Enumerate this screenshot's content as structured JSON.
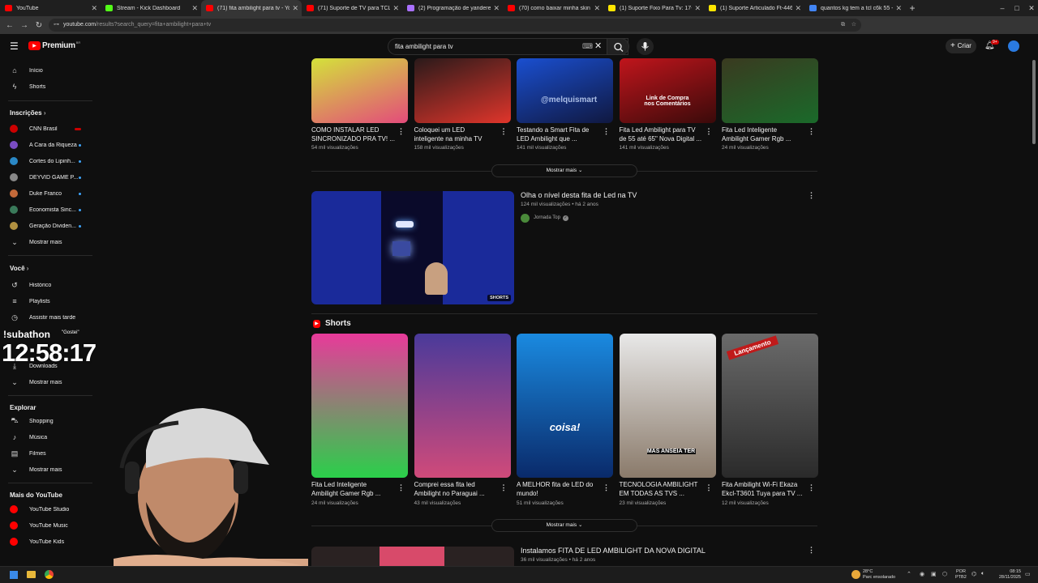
{
  "browser": {
    "tabs": [
      {
        "label": "YouTube",
        "color": "#ff0000",
        "active": false
      },
      {
        "label": "Stream - Kick Dashboard",
        "color": "#53fc18",
        "active": false
      },
      {
        "label": "(71) fita ambilight para tv - You",
        "color": "#ff0000",
        "active": true
      },
      {
        "label": "(71) Suporte de TV para TCL C6",
        "color": "#ff0000",
        "active": false
      },
      {
        "label": "(2) Programação de yandereer",
        "color": "#a970ff",
        "active": false
      },
      {
        "label": "(70) como baixar minha skin do",
        "color": "#ff0000",
        "active": false
      },
      {
        "label": "(1) Suporte Fixo Para Tv: 17-70",
        "color": "#ffe600",
        "active": false
      },
      {
        "label": "(1) Suporte Articulado Ft-446 t",
        "color": "#ffe600",
        "active": false
      },
      {
        "label": "quantos kg tem a tcl c6k 55 - P",
        "color": "#4285f4",
        "active": false
      }
    ],
    "url_host": "youtube.com",
    "url_path": "/results?search_query=fita+ambilight+para+tv"
  },
  "header": {
    "logo": "Premium",
    "logo_sup": "BR",
    "search_value": "fita ambilight para tv",
    "create_label": "Criar",
    "notif_count": "9+"
  },
  "sidebar": {
    "home": "Início",
    "shorts": "Shorts",
    "subs_heading": "Inscrições",
    "subs": [
      {
        "label": "CNN Brasil",
        "color": "#cc0000"
      },
      {
        "label": "A Cara da Riqueza",
        "color": "#7a4cc2"
      },
      {
        "label": "Cortes do Lipinh...",
        "color": "#2a88c6"
      },
      {
        "label": "DEYVID GAME P...",
        "color": "#888888"
      },
      {
        "label": "Duke Franco",
        "color": "#c46a3a"
      },
      {
        "label": "Economista Sinc...",
        "color": "#3a7a5a"
      },
      {
        "label": "Geração Dividen...",
        "color": "#b09040"
      }
    ],
    "show_more": "Mostrar mais",
    "you_heading": "Você",
    "history": "Histórico",
    "playlists": "Playlists",
    "watch_later": "Assistir mais tarde",
    "downloads": "Downloads",
    "show_more2": "Mostrar mais",
    "explore_heading": "Explorar",
    "shopping": "Shopping",
    "music": "Música",
    "films": "Filmes",
    "show_more3": "Mostrar mais",
    "more_heading": "Mais do YouTube",
    "studio": "YouTube Studio",
    "yt_music": "YouTube Music",
    "yt_kids": "YouTube Kids"
  },
  "row1": [
    {
      "title1": "COMO INSTALAR LED",
      "title2": "SINCRONIZADO PRA TV! ...",
      "meta": "54 mil visualizações",
      "c1": "#d4e23a",
      "c2": "#e34b7b"
    },
    {
      "title1": "Coloquei um LED",
      "title2": "inteligente na minha TV",
      "meta": "158 mil visualizações",
      "c1": "#2a1a1a",
      "c2": "#e0352b"
    },
    {
      "title1": "Testando a Smart Fita de",
      "title2": "LED Ambilight que ...",
      "meta": "141 mil visualizações",
      "c1": "#1a4fd0",
      "c2": "#101840",
      "overlay": "@melquismart"
    },
    {
      "title1": "Fita Led Ambilight para TV",
      "title2": "de 55 até 65\" Nova Digital ...",
      "meta": "141 mil visualizações",
      "c1": "#c0151c",
      "c2": "#3a0a0a",
      "overlay": "Link de Compra nos Comentários"
    },
    {
      "title1": "Fita Led Inteligente",
      "title2": "Ambilight Gamer Rgb ...",
      "meta": "24 mil visualizações",
      "c1": "#3a3a20",
      "c2": "#1a6a2a"
    }
  ],
  "show_more_row": "Mostrar mais",
  "feature": {
    "title": "Olha o nível desta fita de Led na TV",
    "meta": "124 mil visualizações • há 2 anos",
    "channel": "Jornada Top",
    "badge": "SHORTS"
  },
  "shorts_heading": "Shorts",
  "shorts": [
    {
      "title1": "Fita Led Inteligente",
      "title2": "Ambilight Gamer Rgb ...",
      "meta": "24 mil visualizações",
      "c1": "#e83a9a",
      "c2": "#2ad04a"
    },
    {
      "title1": "Comprei essa fita led",
      "title2": "Ambilight no Paraguai ...",
      "meta": "43 mil visualizações",
      "c1": "#4a3a9a",
      "c2": "#d04a7a"
    },
    {
      "title1": "A MELHOR fita de LED do",
      "title2": "mundo!",
      "meta": "51 mil visualizações",
      "c1": "#1a8ae0",
      "c2": "#0a2a6a",
      "overlay": "coisa!"
    },
    {
      "title1": "TECNOLOGIA AMBILIGHT",
      "title2": "EM TODAS AS TVS ...",
      "meta": "23 mil visualizações",
      "c1": "#e8e8e8",
      "c2": "#8a7a6a",
      "overlay": "MAS ANSEIA TER"
    },
    {
      "title1": "Fita Ambilight Wi-Fi Ekaza",
      "title2": "Ekcl-T3601 Tuya para TV ...",
      "meta": "12 mil visualizações",
      "c1": "#6a6a6a",
      "c2": "#2a2a2a",
      "overlay": "Lançamento"
    }
  ],
  "show_more_shorts": "Mostrar mais",
  "bottom_video": {
    "title": "Instalamos FITA DE LED AMBILIGHT DA NOVA DIGITAL",
    "meta": "36 mil visualizações • há 2 anos"
  },
  "overlay": {
    "subathon": "!subathon",
    "gostei": "\"Gostei\"",
    "timer": "12:58:17"
  },
  "taskbar": {
    "weather_temp": "28°C",
    "weather_desc": "Parc ensolarado",
    "lang1": "POR",
    "lang2": "PTB2",
    "time": "08:15",
    "date": "28/11/2025"
  }
}
